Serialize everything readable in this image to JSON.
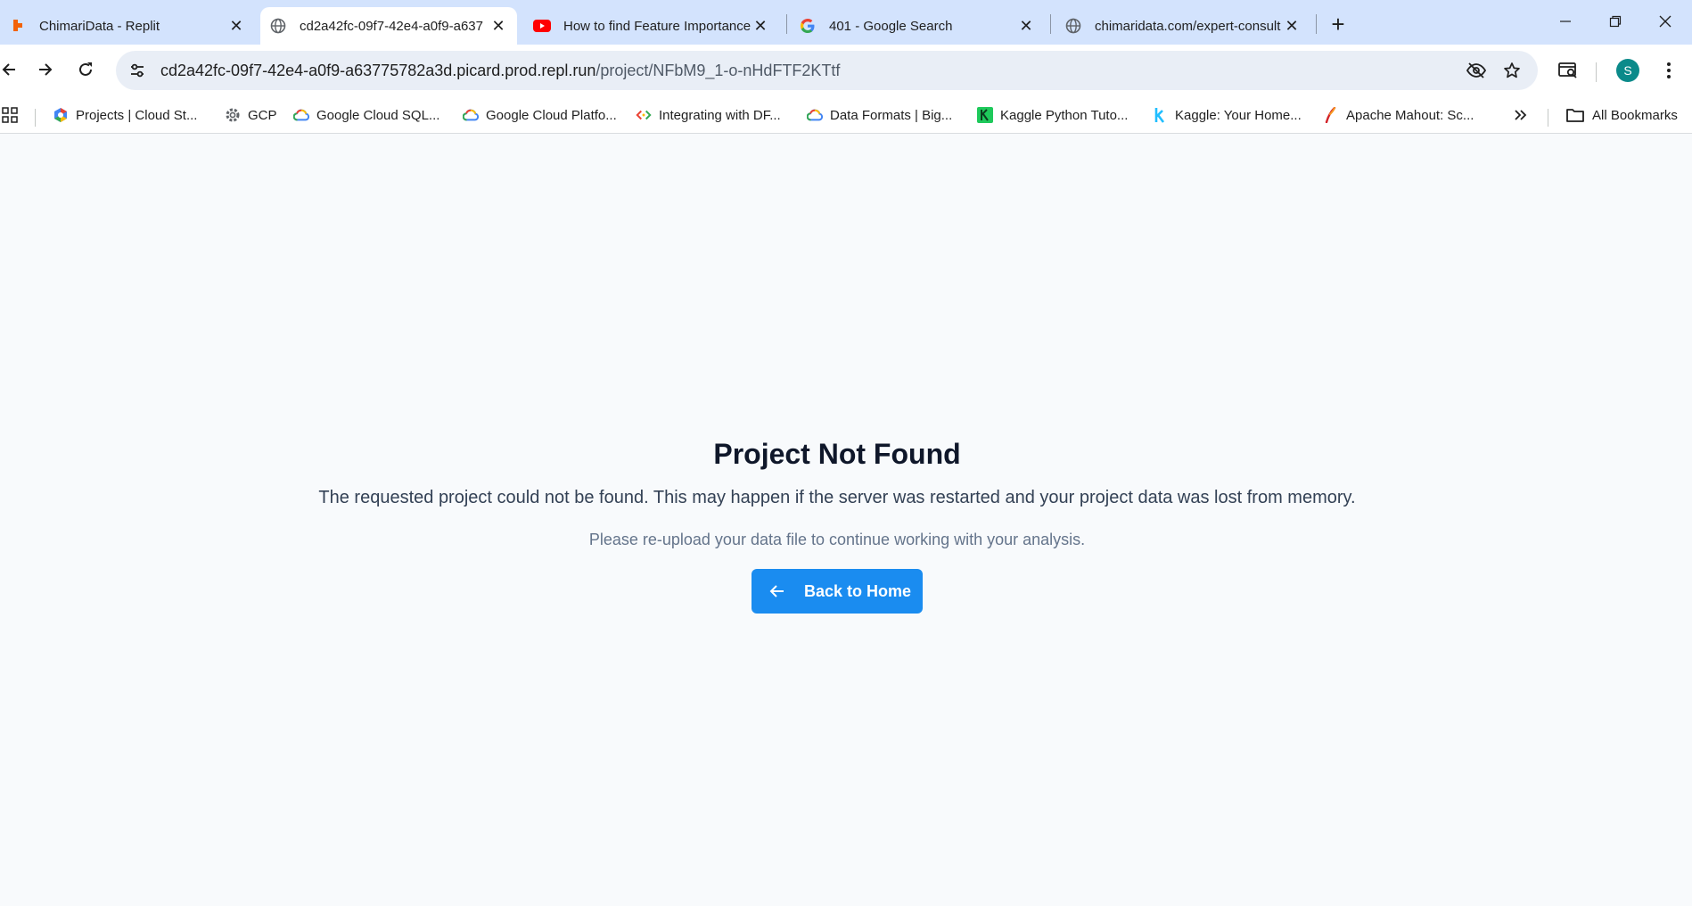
{
  "tabs": [
    {
      "title": "ChimariData - Replit",
      "favicon": "replit-icon",
      "active": false
    },
    {
      "title": "cd2a42fc-09f7-42e4-a0f9-a637",
      "favicon": "globe-icon",
      "active": true
    },
    {
      "title": "How to find Feature Importance",
      "favicon": "youtube-icon",
      "active": false
    },
    {
      "title": "401 - Google Search",
      "favicon": "google-icon",
      "active": false
    },
    {
      "title": "chimaridata.com/expert-consult",
      "favicon": "globe-icon",
      "active": false
    }
  ],
  "address_bar": {
    "host": "cd2a42fc-09f7-42e4-a0f9-a63775782a3d.picard.prod.repl.run",
    "path": "/project/NFbM9_1-o-nHdFTF2KTtf"
  },
  "profile": {
    "initial": "S",
    "color": "#0b8a8a"
  },
  "bookmarks": [
    {
      "label": "Projects | Cloud St...",
      "icon": "gcp-icon"
    },
    {
      "label": "GCP",
      "icon": "gear-icon"
    },
    {
      "label": "Google Cloud SQL...",
      "icon": "google-cloud-icon"
    },
    {
      "label": "Google Cloud Platfo...",
      "icon": "google-cloud-icon"
    },
    {
      "label": "Integrating with DF...",
      "icon": "dialogflow-icon"
    },
    {
      "label": "Data Formats | Big...",
      "icon": "google-cloud-icon"
    },
    {
      "label": "Kaggle Python Tuto...",
      "icon": "kaggle-learn-icon"
    },
    {
      "label": "Kaggle: Your Home...",
      "icon": "kaggle-icon"
    },
    {
      "label": "Apache Mahout: Sc...",
      "icon": "mahout-icon"
    }
  ],
  "all_bookmarks_label": "All Bookmarks",
  "page": {
    "heading": "Project Not Found",
    "description": "The requested project could not be found. This may happen if the server was restarted and your project data was lost from memory.",
    "hint": "Please re-upload your data file to continue working with your analysis.",
    "back_button_label": "Back to Home"
  },
  "colors": {
    "primary_button": "#1a8cf0",
    "tabstrip": "#d3e3fd",
    "page_background": "#f8fafc"
  }
}
